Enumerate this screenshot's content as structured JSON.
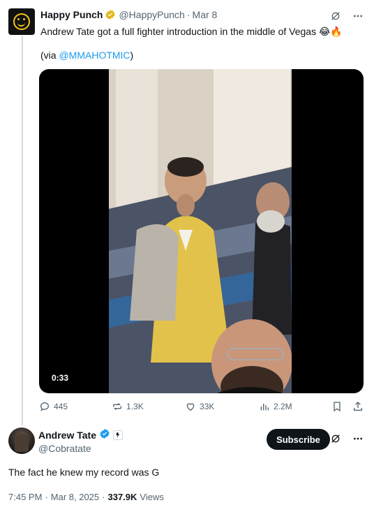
{
  "quoted_tweet": {
    "author_name": "Happy Punch",
    "author_handle": "@HappyPunch",
    "separator": "·",
    "date": "Mar 8",
    "text": "Andrew Tate got a full fighter introduction in the middle of Vegas 😂🔥",
    "via_prefix": "(via ",
    "via_link": "@MMAHOTMIC",
    "via_suffix": ")",
    "video_duration": "0:33",
    "stats": {
      "replies": "445",
      "reposts": "1.3K",
      "likes": "33K",
      "views": "2.2M"
    }
  },
  "main_tweet": {
    "author_name": "Andrew Tate",
    "author_handle": "@Cobratate",
    "subscribe_label": "Subscribe",
    "text": "The fact he knew my record was G",
    "time": "7:45 PM",
    "date": "Mar 8, 2025",
    "separator": "·",
    "views_count": "337.9K",
    "views_label": "Views"
  },
  "colors": {
    "link": "#1d9bf0",
    "muted": "#536471",
    "gold_verified": "#e2b719",
    "blue_verified": "#1d9bf0"
  },
  "icons": [
    "grok-icon",
    "more-icon",
    "reply-icon",
    "repost-icon",
    "like-icon",
    "views-icon",
    "bookmark-icon",
    "share-icon",
    "verified-badge-icon",
    "affiliate-badge-icon"
  ]
}
